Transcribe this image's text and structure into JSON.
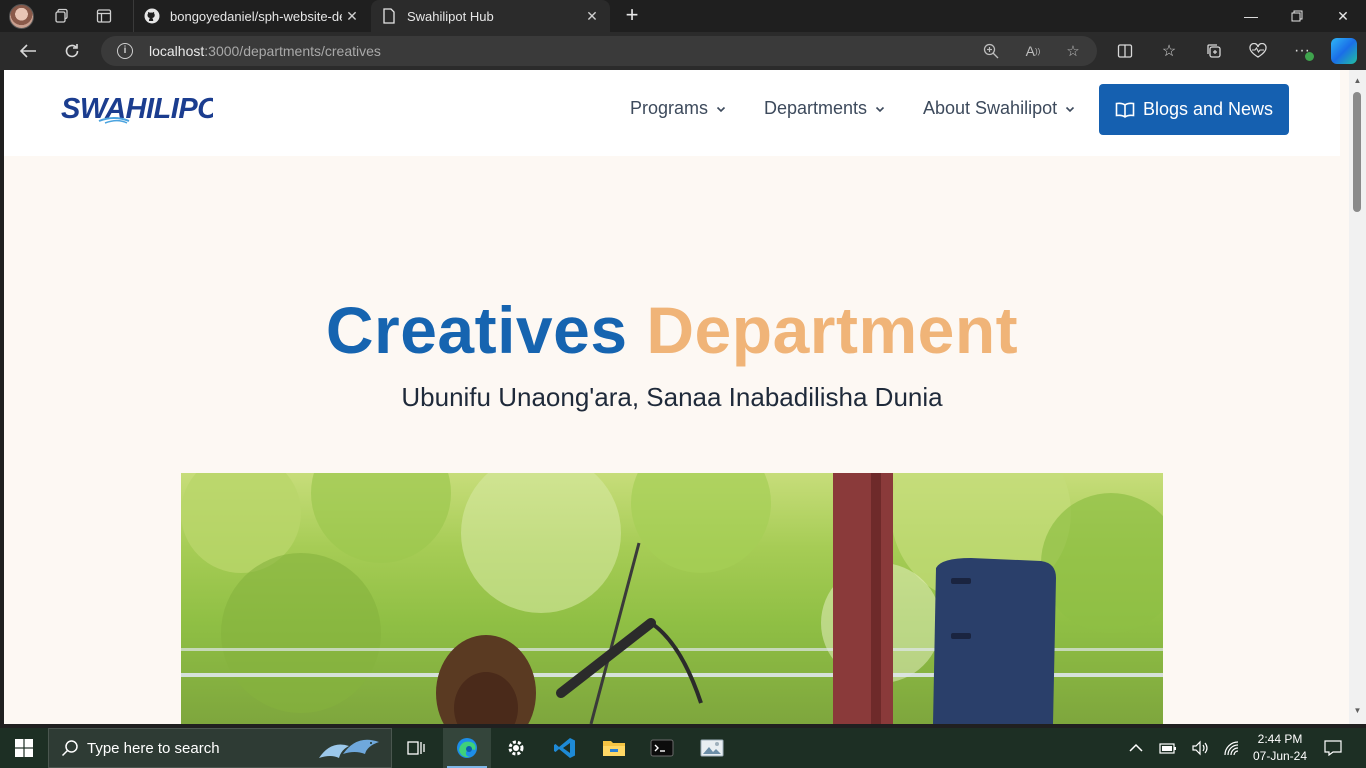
{
  "browser": {
    "tabs": [
      {
        "title": "bongoyedaniel/sph-website-dev",
        "favicon": "github-icon"
      },
      {
        "title": "Swahilipot Hub",
        "favicon": "page-icon"
      }
    ],
    "url_host": "localhost",
    "url_path": ":3000/departments/creatives"
  },
  "site": {
    "logo_text": "SWAHILIPOT",
    "nav": [
      {
        "label": "Programs"
      },
      {
        "label": "Departments"
      },
      {
        "label": "About Swahilipot"
      }
    ],
    "cta_label": "Blogs and News"
  },
  "hero": {
    "title_part1": "Creatives",
    "title_part2": "Department",
    "subtitle": "Ubunifu Unaong'ara, Sanaa Inabadilisha Dunia"
  },
  "colors": {
    "brand_blue": "#1664b0",
    "accent_orange": "#f0b478",
    "cta_blue": "#1560b0"
  },
  "taskbar": {
    "search_placeholder": "Type here to search",
    "time": "2:44 PM",
    "date": "07-Jun-24",
    "apps": [
      "task-view-icon",
      "edge-icon",
      "settings-icon",
      "vscode-icon",
      "file-explorer-icon",
      "terminal-icon",
      "photos-icon"
    ]
  }
}
